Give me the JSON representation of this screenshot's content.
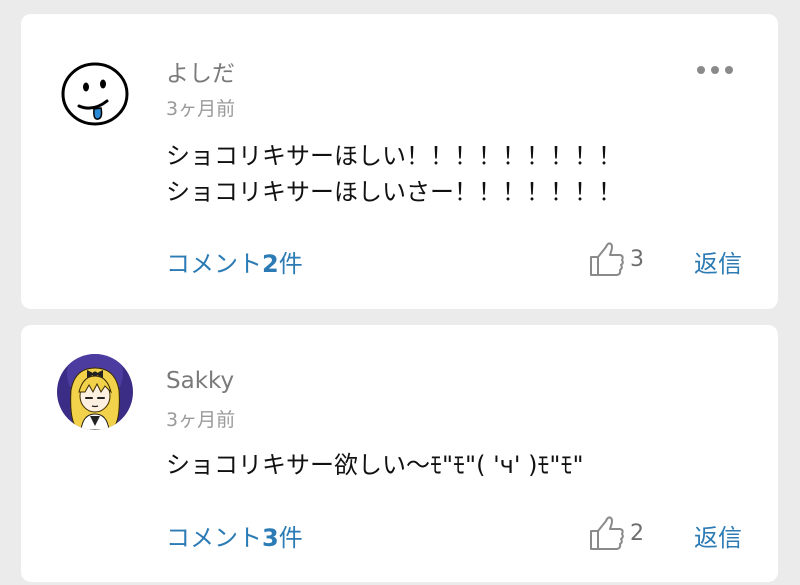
{
  "comments": [
    {
      "username": "よしだ",
      "time": "3ヶ月前",
      "lines": [
        "ショコリキサーほしい！！！！！！！！！",
        "ショコリキサーほしいさー！！！！！！！"
      ],
      "replies_prefix": "コメント",
      "replies_count": "2",
      "replies_suffix": "件",
      "likes": "3",
      "reply_label": "返信",
      "avatar_icon": "smiley-tongue-avatar-icon",
      "has_more_menu": true
    },
    {
      "username": "Sakky",
      "time": "3ヶ月前",
      "lines": [
        "ショコリキサー欲しい〜ﾓ\"ﾓ\"( 'ч' )ﾓ\"ﾓ\""
      ],
      "replies_prefix": "コメント",
      "replies_count": "3",
      "replies_suffix": "件",
      "likes": "2",
      "reply_label": "返信",
      "avatar_icon": "anime-girl-avatar-icon",
      "has_more_menu": false
    }
  ],
  "colors": {
    "background": "#ebebeb",
    "card": "#ffffff",
    "link": "#2c7bb5",
    "username": "#7a7a7a",
    "timestamp": "#9a9a9a",
    "body_text": "#111111"
  },
  "icons": {
    "like": "thumbs-up-icon",
    "more": "more-dots-icon"
  }
}
